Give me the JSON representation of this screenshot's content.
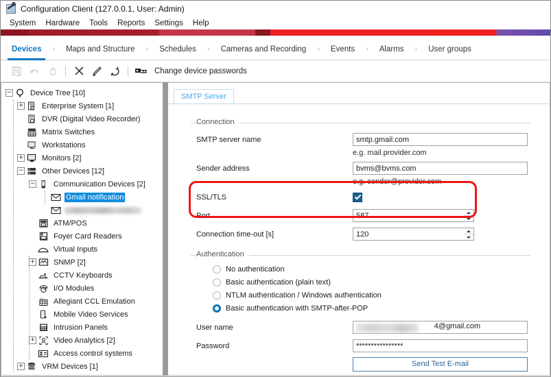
{
  "window": {
    "title": "Configuration Client (127.0.0.1, User: Admin)",
    "icon": "wrench-icon"
  },
  "menu": {
    "items": [
      "System",
      "Hardware",
      "Tools",
      "Reports",
      "Settings",
      "Help"
    ]
  },
  "nav": {
    "separator": "›",
    "tabs": [
      {
        "label": "Devices",
        "active": true
      },
      {
        "label": "Maps and Structure",
        "active": false
      },
      {
        "label": "Schedules",
        "active": false
      },
      {
        "label": "Cameras and Recording",
        "active": false
      },
      {
        "label": "Events",
        "active": false
      },
      {
        "label": "Alarms",
        "active": false
      },
      {
        "label": "User groups",
        "active": false
      }
    ]
  },
  "toolbar": {
    "buttons": [
      {
        "name": "save-icon",
        "enabled": false
      },
      {
        "name": "undo-icon",
        "enabled": false
      },
      {
        "name": "hand-icon",
        "enabled": false
      },
      {
        "name": "delete-icon",
        "enabled": true
      },
      {
        "name": "edit-icon",
        "enabled": true
      },
      {
        "name": "refresh-icon",
        "enabled": true
      },
      {
        "name": "key-icon",
        "enabled": true
      }
    ],
    "change_passwords_label": "Change device passwords"
  },
  "tree": {
    "nodes": [
      {
        "label": "Device Tree [10]",
        "indent": 0,
        "expander": "-",
        "icon": "device-tree-icon",
        "selected": false
      },
      {
        "label": "Enterprise System [1]",
        "indent": 1,
        "expander": "+",
        "icon": "enterprise-system-icon",
        "selected": false
      },
      {
        "label": "DVR (Digital Video Recorder)",
        "indent": 1,
        "expander": "",
        "icon": "dvr-icon",
        "selected": false
      },
      {
        "label": "Matrix Switches",
        "indent": 1,
        "expander": "",
        "icon": "matrix-switch-icon",
        "selected": false
      },
      {
        "label": "Workstations",
        "indent": 1,
        "expander": "",
        "icon": "workstation-icon",
        "selected": false
      },
      {
        "label": "Monitors [2]",
        "indent": 1,
        "expander": "+",
        "icon": "monitor-icon",
        "selected": false
      },
      {
        "label": "Other Devices [12]",
        "indent": 1,
        "expander": "-",
        "icon": "other-devices-icon",
        "selected": false
      },
      {
        "label": "Communication Devices [2]",
        "indent": 2,
        "expander": "-",
        "icon": "communication-device-icon",
        "selected": false
      },
      {
        "label": "Gmail notification",
        "indent": 3,
        "expander": "",
        "icon": "envelope-icon",
        "selected": true
      },
      {
        "label": "",
        "indent": 3,
        "expander": "",
        "icon": "envelope-icon",
        "selected": false,
        "blurred": true
      },
      {
        "label": "ATM/POS",
        "indent": 2,
        "expander": "",
        "icon": "atm-pos-icon",
        "selected": false
      },
      {
        "label": "Foyer Card Readers",
        "indent": 2,
        "expander": "",
        "icon": "card-reader-icon",
        "selected": false
      },
      {
        "label": "Virtual Inputs",
        "indent": 2,
        "expander": "",
        "icon": "virtual-input-icon",
        "selected": false
      },
      {
        "label": "SNMP [2]",
        "indent": 2,
        "expander": "+",
        "icon": "snmp-icon",
        "selected": false
      },
      {
        "label": "CCTV Keyboards",
        "indent": 2,
        "expander": "",
        "icon": "keyboard-icon",
        "selected": false
      },
      {
        "label": "I/O Modules",
        "indent": 2,
        "expander": "",
        "icon": "io-module-icon",
        "selected": false
      },
      {
        "label": "Allegiant CCL Emulation",
        "indent": 2,
        "expander": "",
        "icon": "ccl-emulation-icon",
        "selected": false
      },
      {
        "label": "Mobile Video Services",
        "indent": 2,
        "expander": "",
        "icon": "mobile-video-icon",
        "selected": false
      },
      {
        "label": "Intrusion Panels",
        "indent": 2,
        "expander": "",
        "icon": "intrusion-panel-icon",
        "selected": false
      },
      {
        "label": "Video Analytics [2]",
        "indent": 2,
        "expander": "+",
        "icon": "video-analytics-icon",
        "selected": false
      },
      {
        "label": "Access control systems",
        "indent": 2,
        "expander": "",
        "icon": "access-control-icon",
        "selected": false
      },
      {
        "label": "VRM Devices [1]",
        "indent": 1,
        "expander": "+",
        "icon": "vrm-device-icon",
        "selected": false
      }
    ]
  },
  "panel": {
    "tab_label": "SMTP Server",
    "connection": {
      "title": "Connection",
      "smtp_server_name_label": "SMTP server name",
      "smtp_server_name_value": "smtp.gmail.com",
      "smtp_server_name_hint": "e.g. mail.provider.com",
      "sender_address_label": "Sender address",
      "sender_address_value": "bvms@bvms.com",
      "sender_address_hint": "e.g. sender@provider.com",
      "ssl_tls_label": "SSL/TLS",
      "ssl_tls_checked": true,
      "port_label": "Port",
      "port_value": "587",
      "timeout_label": "Connection time-out [s]",
      "timeout_value": "120"
    },
    "authentication": {
      "title": "Authentication",
      "options": [
        {
          "label": "No authentication",
          "selected": false
        },
        {
          "label": "Basic authentication (plain text)",
          "selected": false
        },
        {
          "label": "NTLM authentication / Windows authentication",
          "selected": false
        },
        {
          "label": "Basic authentication with SMTP-after-POP",
          "selected": true
        }
      ],
      "user_name_label": "User name",
      "user_name_value": "4@gmail.com",
      "password_label": "Password",
      "password_value": "****************",
      "send_test_email_label": "Send Test E-mail"
    }
  },
  "highlight": {
    "color": "#f01414"
  }
}
